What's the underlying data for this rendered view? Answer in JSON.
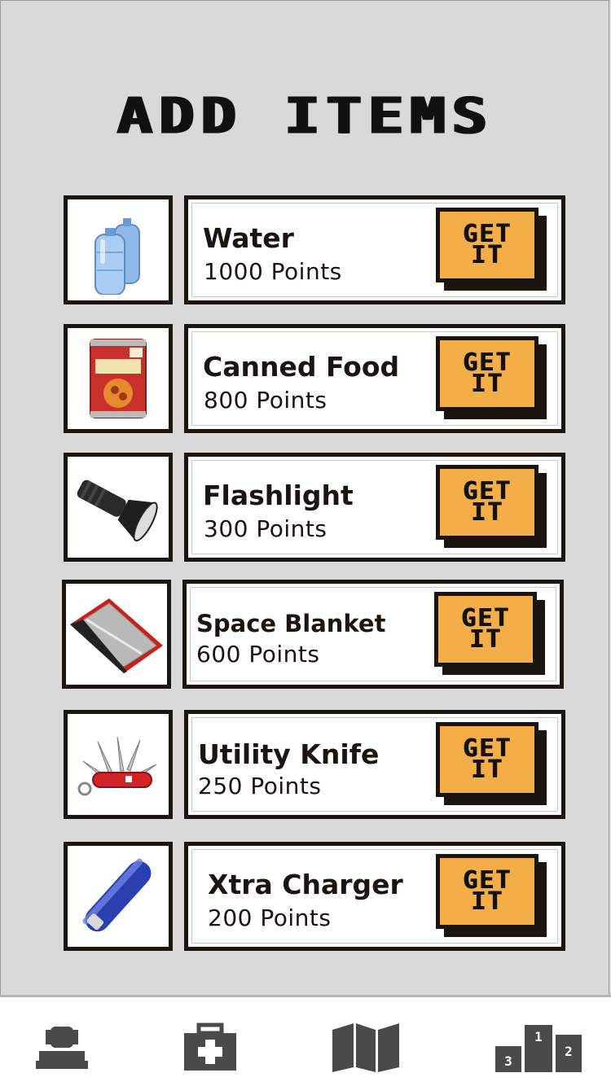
{
  "title": "ADD ITEMS",
  "items": [
    {
      "name": "Water",
      "points": "1000 Points",
      "button": "GET IT",
      "icon": "water-jug-icon"
    },
    {
      "name": "Canned Food",
      "points": "800 Points",
      "button": "GET IT",
      "icon": "canned-food-icon"
    },
    {
      "name": "Flashlight",
      "points": "300 Points",
      "button": "GET IT",
      "icon": "flashlight-icon"
    },
    {
      "name": "Space Blanket",
      "points": "600 Points",
      "button": "GET IT",
      "icon": "space-blanket-icon"
    },
    {
      "name": "Utility Knife",
      "points": "250 Points",
      "button": "GET IT",
      "icon": "utility-knife-icon"
    },
    {
      "name": "Xtra Charger",
      "points": "200 Points",
      "button": "GET IT",
      "icon": "charger-icon"
    }
  ],
  "tabbar": {
    "tabs": [
      {
        "icon": "profile-icon"
      },
      {
        "icon": "first-aid-kit-icon"
      },
      {
        "icon": "map-icon"
      },
      {
        "icon": "leaderboard-podium-icon"
      }
    ],
    "podium_labels": [
      "3",
      "1",
      "2"
    ]
  },
  "colors": {
    "background": "#d9d9d9",
    "button": "#f4ae48",
    "border": "#1c1410",
    "tab_icon": "#4a4a4a"
  }
}
